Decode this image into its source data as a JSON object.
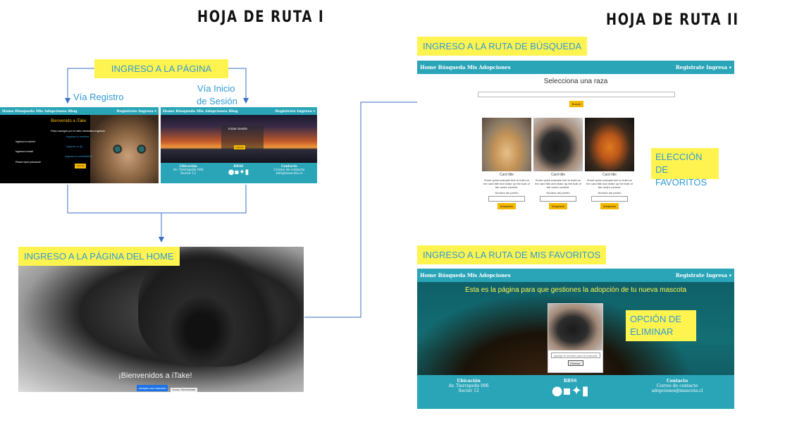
{
  "titles": {
    "left": "HOJA DE RUTA I",
    "right": "HOJA DE RUTA II"
  },
  "labels": {
    "ingreso_pagina": "INGRESO A LA PÁGINA",
    "via_registro": "Vía Registro",
    "via_inicio": "Vía Inicio",
    "de_sesion": "de Sesión",
    "ingreso_home": "INGRESO A LA PÁGINA DEL HOME",
    "ingreso_busqueda": "INGRESO A LA RUTA DE BÚSQUEDA",
    "eleccion_1": "ELECCIÓN DE",
    "eleccion_2": "FAVORITOS",
    "ingreso_favoritos": "INGRESO A LA RUTA DE MIS FAVORITOS",
    "opcion_1": "OPCIÓN DE",
    "opcion_2": "ELIMINAR"
  },
  "registro": {
    "nav_left": "Home Búsqueda Mis Adopciones Blog",
    "nav_right": "Registrate Ingresa ▾",
    "welcome": "Bienvenido a iTake",
    "subtitle": "Para navegar por el sitio necesitas ingresar",
    "field_1_label": "Ingresa tu nombre",
    "field_1_hint": "Ingresa tu nombre",
    "field_2_label": "Ingresa tu email",
    "field_2_hint": "Ingresa tu @...",
    "field_3_label": "Please input password!",
    "field_3_hint": "Ingresa tu contraseña",
    "button": "Ingresar"
  },
  "login": {
    "nav_left": "Home Búsqueda Mis Adopciones Blog",
    "nav_right": "Registrate Ingresa ▾",
    "heading": "Iniciar Sesión",
    "button": "Ingresar",
    "footer_ubicacion": "Ubicación",
    "footer_address": "Av. Tierrapolis 006",
    "footer_sector": "Sector 12",
    "footer_rrss": "RRSS",
    "footer_contacto": "Contacto",
    "footer_correo": "Correo de contacto",
    "footer_email": "info@mascota.cl"
  },
  "home": {
    "welcome": "¡Bienvenidos a iTake!",
    "button_1": "¡Adopta una mascota!",
    "button_2": "Dona / Benefíciate"
  },
  "search": {
    "nav_left": "Home Búsqueda Mis Adopciones",
    "nav_right": "Registrate Ingresa ▾",
    "heading": "Selecciona una raza",
    "button": "Buscar",
    "cards": [
      {
        "title": "Card title",
        "text": "Some quick example text to build on the card title and make up the bulk of the card's content.",
        "input_label": "Nombre del perrito",
        "button": "Adoptame"
      },
      {
        "title": "Card title",
        "text": "Some quick example text to build on the card title and make up the bulk of the card's content.",
        "input_label": "Nombre del perrito",
        "button": "Adoptame"
      },
      {
        "title": "Card title",
        "text": "Some quick example text to build on the card title and make up the bulk of the card's content.",
        "input_label": "Nombre del perrito",
        "button": "Adoptame"
      }
    ]
  },
  "favorites": {
    "nav_left": "Home Búsqueda Mis Adopciones",
    "nav_right": "Registrate Ingresa ▾",
    "heading": "Esta es la página para que gestiones la adopción de tu nueva mascota",
    "card_input": "Agrega el nombre para tu mascota",
    "card_button": "Eliminar",
    "footer_ubicacion": "Ubicación",
    "footer_address": "Av. Tierrapolis 006",
    "footer_sector": "Sector 12",
    "footer_rrss": "RRSS",
    "footer_contacto": "Contacto",
    "footer_correo": "Correo de contacto",
    "footer_email": "adopciones@mascota.cl"
  },
  "icons": [
    "github-icon",
    "linkedin-icon",
    "twitter-icon",
    "facebook-icon"
  ],
  "colors": {
    "highlight": "#fff44f",
    "label_text": "#2f9ad6",
    "navbar": "#2aa5b8",
    "button": "#f5b800",
    "arrow": "#3a6fc4"
  }
}
